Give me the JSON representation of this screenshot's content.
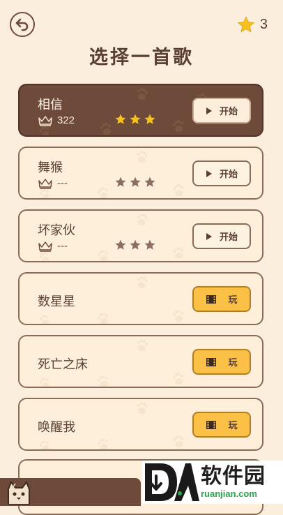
{
  "header": {
    "title": "选择一首歌",
    "star_total": "3"
  },
  "songs": [
    {
      "title": "相信",
      "score": "322",
      "stars_earned": 3,
      "action": "开始",
      "action_icon": "play-icon",
      "selected": true
    },
    {
      "title": "舞猴",
      "score": "---",
      "stars_earned": 0,
      "action": "开始",
      "action_icon": "play-icon",
      "selected": false
    },
    {
      "title": "坏家伙",
      "score": "---",
      "stars_earned": 0,
      "action": "开始",
      "action_icon": "play-icon",
      "selected": false
    },
    {
      "title": "数星星",
      "action": "玩",
      "action_icon": "video-ad-icon",
      "locked": true
    },
    {
      "title": "死亡之床",
      "action": "玩",
      "action_icon": "video-ad-icon",
      "locked": true
    },
    {
      "title": "唤醒我",
      "action": "玩",
      "action_icon": "video-ad-icon",
      "locked": true
    }
  ],
  "watermark": {
    "logo_text": "DA",
    "name": "软件园",
    "url": "ruanjian.com"
  },
  "colors": {
    "background": "#fbeedd",
    "card": "#fdefd9",
    "card_selected": "#6e4a3a",
    "brown": "#5a3f33",
    "gold_star": "#f6c21b",
    "play_button": "#fbc046",
    "watermark_green": "#2aa64a"
  }
}
